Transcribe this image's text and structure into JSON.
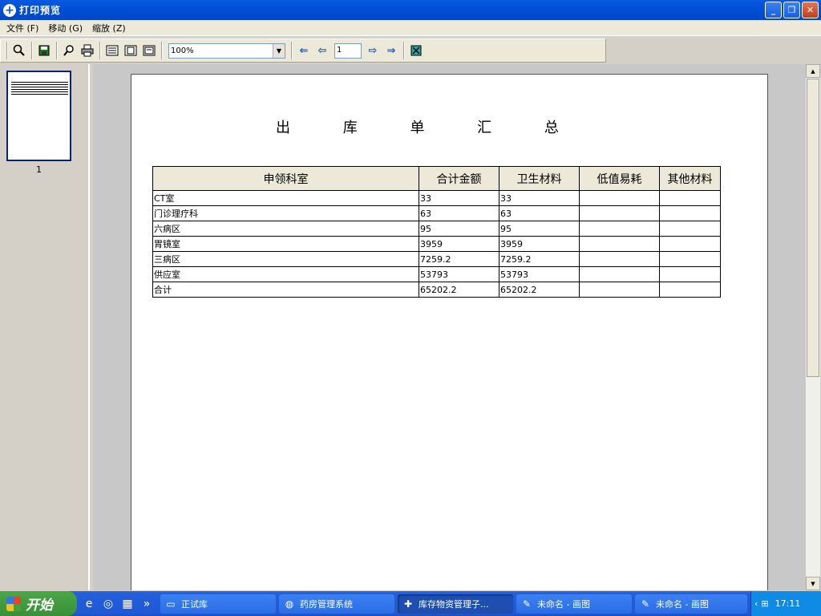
{
  "window": {
    "title": "打印预览",
    "minimize": "_",
    "restore": "❐",
    "close": "✕"
  },
  "menu": [
    "文件 (F)",
    "移动 (G)",
    "缩放 (Z)"
  ],
  "toolbar": {
    "zoom_value": "100%",
    "page_value": "1"
  },
  "thumbnail": {
    "page_number": "1"
  },
  "report": {
    "title": "出 库 单 汇 总",
    "columns": [
      "申领科室",
      "合计金额",
      "卫生材料",
      "低值易耗",
      "其他材料"
    ],
    "rows": [
      [
        "CT室",
        "33",
        "33",
        "",
        ""
      ],
      [
        "门诊理疗科",
        "63",
        "63",
        "",
        ""
      ],
      [
        "六病区",
        "95",
        "95",
        "",
        ""
      ],
      [
        "胃镜室",
        "3959",
        "3959",
        "",
        ""
      ],
      [
        "三病区",
        "7259.2",
        "7259.2",
        "",
        ""
      ],
      [
        "供应室",
        "53793",
        "53793",
        "",
        ""
      ],
      [
        "合计",
        "65202.2",
        "65202.2",
        "",
        ""
      ]
    ]
  },
  "taskbar": {
    "start_label": "开始",
    "tasks": [
      {
        "label": "正试库",
        "icon": "folder-icon"
      },
      {
        "label": "药房管理系统",
        "icon": "pharmacy-app-icon"
      },
      {
        "label": "库存物资管理子...",
        "icon": "app-plus-icon"
      },
      {
        "label": "未命名 - 画图",
        "icon": "paint-icon"
      },
      {
        "label": "未命名 - 画图",
        "icon": "paint-icon"
      }
    ],
    "clock": "17:11"
  }
}
